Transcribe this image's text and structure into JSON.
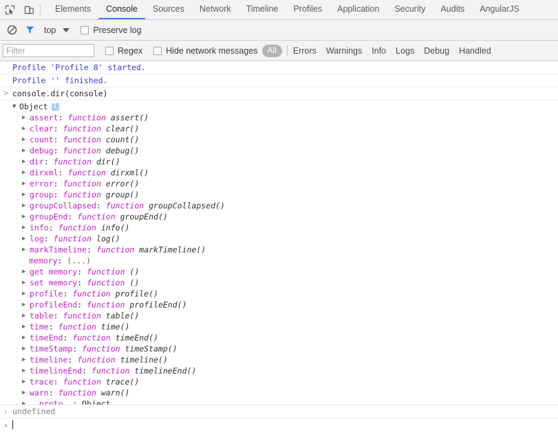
{
  "tabbar": {
    "inspect_icon": "inspect-element-icon",
    "device_icon": "device-toolbar-icon",
    "tabs": [
      {
        "label": "Elements",
        "selected": false
      },
      {
        "label": "Console",
        "selected": true
      },
      {
        "label": "Sources",
        "selected": false
      },
      {
        "label": "Network",
        "selected": false
      },
      {
        "label": "Timeline",
        "selected": false
      },
      {
        "label": "Profiles",
        "selected": false
      },
      {
        "label": "Application",
        "selected": false
      },
      {
        "label": "Security",
        "selected": false
      },
      {
        "label": "Audits",
        "selected": false
      },
      {
        "label": "AngularJS",
        "selected": false
      }
    ]
  },
  "toolbar": {
    "clear_icon": "clear-console-icon",
    "filter_icon": "filter-icon",
    "context_label": "top",
    "context_caret": "chevron-down-icon",
    "preserve_log_label": "Preserve log",
    "preserve_log_checked": false
  },
  "filterbar": {
    "filter_placeholder": "Filter",
    "filter_value": "",
    "regex_label": "Regex",
    "regex_checked": false,
    "hide_network_label": "Hide network messages",
    "hide_network_checked": false,
    "levels": [
      {
        "label": "All",
        "selected": true
      },
      {
        "label": "Errors",
        "selected": false
      },
      {
        "label": "Warnings",
        "selected": false
      },
      {
        "label": "Info",
        "selected": false
      },
      {
        "label": "Logs",
        "selected": false
      },
      {
        "label": "Debug",
        "selected": false
      },
      {
        "label": "Handled",
        "selected": false
      }
    ]
  },
  "console": {
    "messages": [
      {
        "type": "profile",
        "text": "Profile 'Profile 8' started."
      },
      {
        "type": "profile",
        "text": "Profile '' finished."
      },
      {
        "type": "command",
        "prefix": ">",
        "text": "console.dir(console)"
      }
    ],
    "object": {
      "triangle": "▼",
      "name": "Object",
      "info_badge": "i",
      "properties": [
        {
          "triangle": "▶",
          "name": "assert",
          "kind": "function",
          "sig": "assert()"
        },
        {
          "triangle": "▶",
          "name": "clear",
          "kind": "function",
          "sig": "clear()"
        },
        {
          "triangle": "▶",
          "name": "count",
          "kind": "function",
          "sig": "count()"
        },
        {
          "triangle": "▶",
          "name": "debug",
          "kind": "function",
          "sig": "debug()"
        },
        {
          "triangle": "▶",
          "name": "dir",
          "kind": "function",
          "sig": "dir()"
        },
        {
          "triangle": "▶",
          "name": "dirxml",
          "kind": "function",
          "sig": "dirxml()"
        },
        {
          "triangle": "▶",
          "name": "error",
          "kind": "function",
          "sig": "error()"
        },
        {
          "triangle": "▶",
          "name": "group",
          "kind": "function",
          "sig": "group()"
        },
        {
          "triangle": "▶",
          "name": "groupCollapsed",
          "kind": "function",
          "sig": "groupCollapsed()"
        },
        {
          "triangle": "▶",
          "name": "groupEnd",
          "kind": "function",
          "sig": "groupEnd()"
        },
        {
          "triangle": "▶",
          "name": "info",
          "kind": "function",
          "sig": "info()"
        },
        {
          "triangle": "▶",
          "name": "log",
          "kind": "function",
          "sig": "log()"
        },
        {
          "triangle": "▶",
          "name": "markTimeline",
          "kind": "function",
          "sig": "markTimeline()"
        },
        {
          "triangle": "",
          "name": "memory",
          "kind": "dim",
          "sig": "(...)"
        },
        {
          "triangle": "▶",
          "name": "get memory",
          "kind": "function",
          "sig": "()"
        },
        {
          "triangle": "▶",
          "name": "set memory",
          "kind": "function",
          "sig": "()"
        },
        {
          "triangle": "▶",
          "name": "profile",
          "kind": "function",
          "sig": "profile()"
        },
        {
          "triangle": "▶",
          "name": "profileEnd",
          "kind": "function",
          "sig": "profileEnd()"
        },
        {
          "triangle": "▶",
          "name": "table",
          "kind": "function",
          "sig": "table()"
        },
        {
          "triangle": "▶",
          "name": "time",
          "kind": "function",
          "sig": "time()"
        },
        {
          "triangle": "▶",
          "name": "timeEnd",
          "kind": "function",
          "sig": "timeEnd()"
        },
        {
          "triangle": "▶",
          "name": "timeStamp",
          "kind": "function",
          "sig": "timeStamp()"
        },
        {
          "triangle": "▶",
          "name": "timeline",
          "kind": "function",
          "sig": "timeline()"
        },
        {
          "triangle": "▶",
          "name": "timelineEnd",
          "kind": "function",
          "sig": "timelineEnd()"
        },
        {
          "triangle": "▶",
          "name": "trace",
          "kind": "function",
          "sig": "trace()"
        },
        {
          "triangle": "▶",
          "name": "warn",
          "kind": "function",
          "sig": "warn()"
        },
        {
          "triangle": "▶",
          "name": "__proto__",
          "kind": "plain",
          "sig": "Object"
        }
      ]
    }
  },
  "bottom": {
    "result_prefix": "‹",
    "result_text": "undefined",
    "prompt_prefix": "›",
    "prompt_value": ""
  },
  "colors": {
    "accent_blue": "#4285f4",
    "property_magenta": "#c421c4",
    "profile_blue": "#3b3bdd",
    "chrome_bg": "#f3f3f3"
  }
}
